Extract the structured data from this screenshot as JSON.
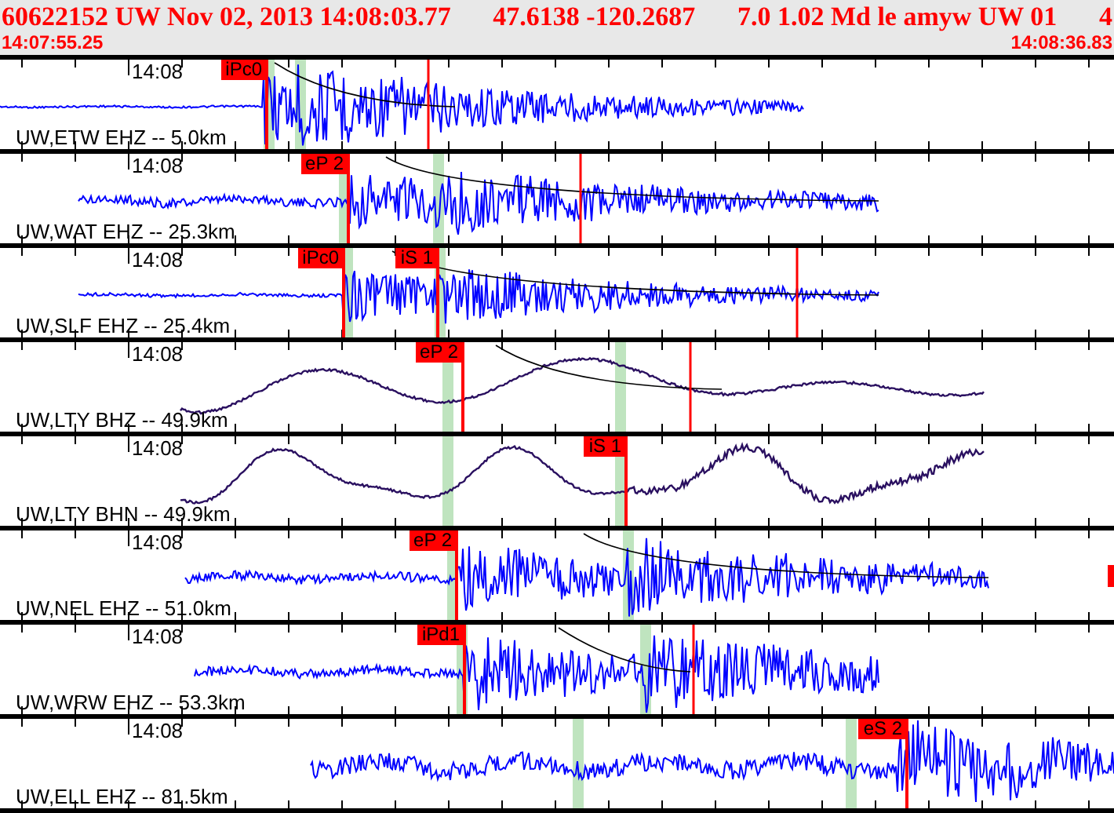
{
  "header": {
    "event": "60622152 UW Nov 02, 2013 14:08:03.77",
    "location": "47.6138 -120.2687",
    "magnitude": "7.0 1.02 Md le amyw UW 01",
    "count": "4",
    "start_time": "14:07:55.25",
    "end_time": "14:08:36.83"
  },
  "traces": [
    {
      "label": "UW,ETW EHZ -- 5.0km",
      "time_label": "14:08",
      "kind": "short-period",
      "picks": [
        {
          "label": "iPc0"
        }
      ]
    },
    {
      "label": "UW,WAT EHZ -- 25.3km",
      "time_label": "14:08",
      "kind": "short-period",
      "picks": [
        {
          "label": "eP 2"
        }
      ]
    },
    {
      "label": "UW,SLF EHZ -- 25.4km",
      "time_label": "14:08",
      "kind": "short-period",
      "picks": [
        {
          "label": "iPc0"
        },
        {
          "label": "iS 1"
        }
      ]
    },
    {
      "label": "UW,LTY BHZ -- 49.9km",
      "time_label": "14:08",
      "kind": "broadband",
      "picks": [
        {
          "label": "eP 2"
        }
      ]
    },
    {
      "label": "UW,LTY BHN -- 49.9km",
      "time_label": "14:08",
      "kind": "broadband",
      "picks": [
        {
          "label": "iS 1"
        }
      ]
    },
    {
      "label": "UW,NEL EHZ -- 51.0km",
      "time_label": "14:08",
      "kind": "short-period",
      "picks": [
        {
          "label": "eP 2"
        }
      ]
    },
    {
      "label": "UW,WRW EHZ -- 53.3km",
      "time_label": "14:08",
      "kind": "short-period",
      "picks": [
        {
          "label": "iPd1"
        }
      ]
    },
    {
      "label": "UW,ELL EHZ -- 81.5km",
      "time_label": "14:08",
      "kind": "short-period",
      "picks": [
        {
          "label": "eS 2"
        }
      ]
    }
  ]
}
